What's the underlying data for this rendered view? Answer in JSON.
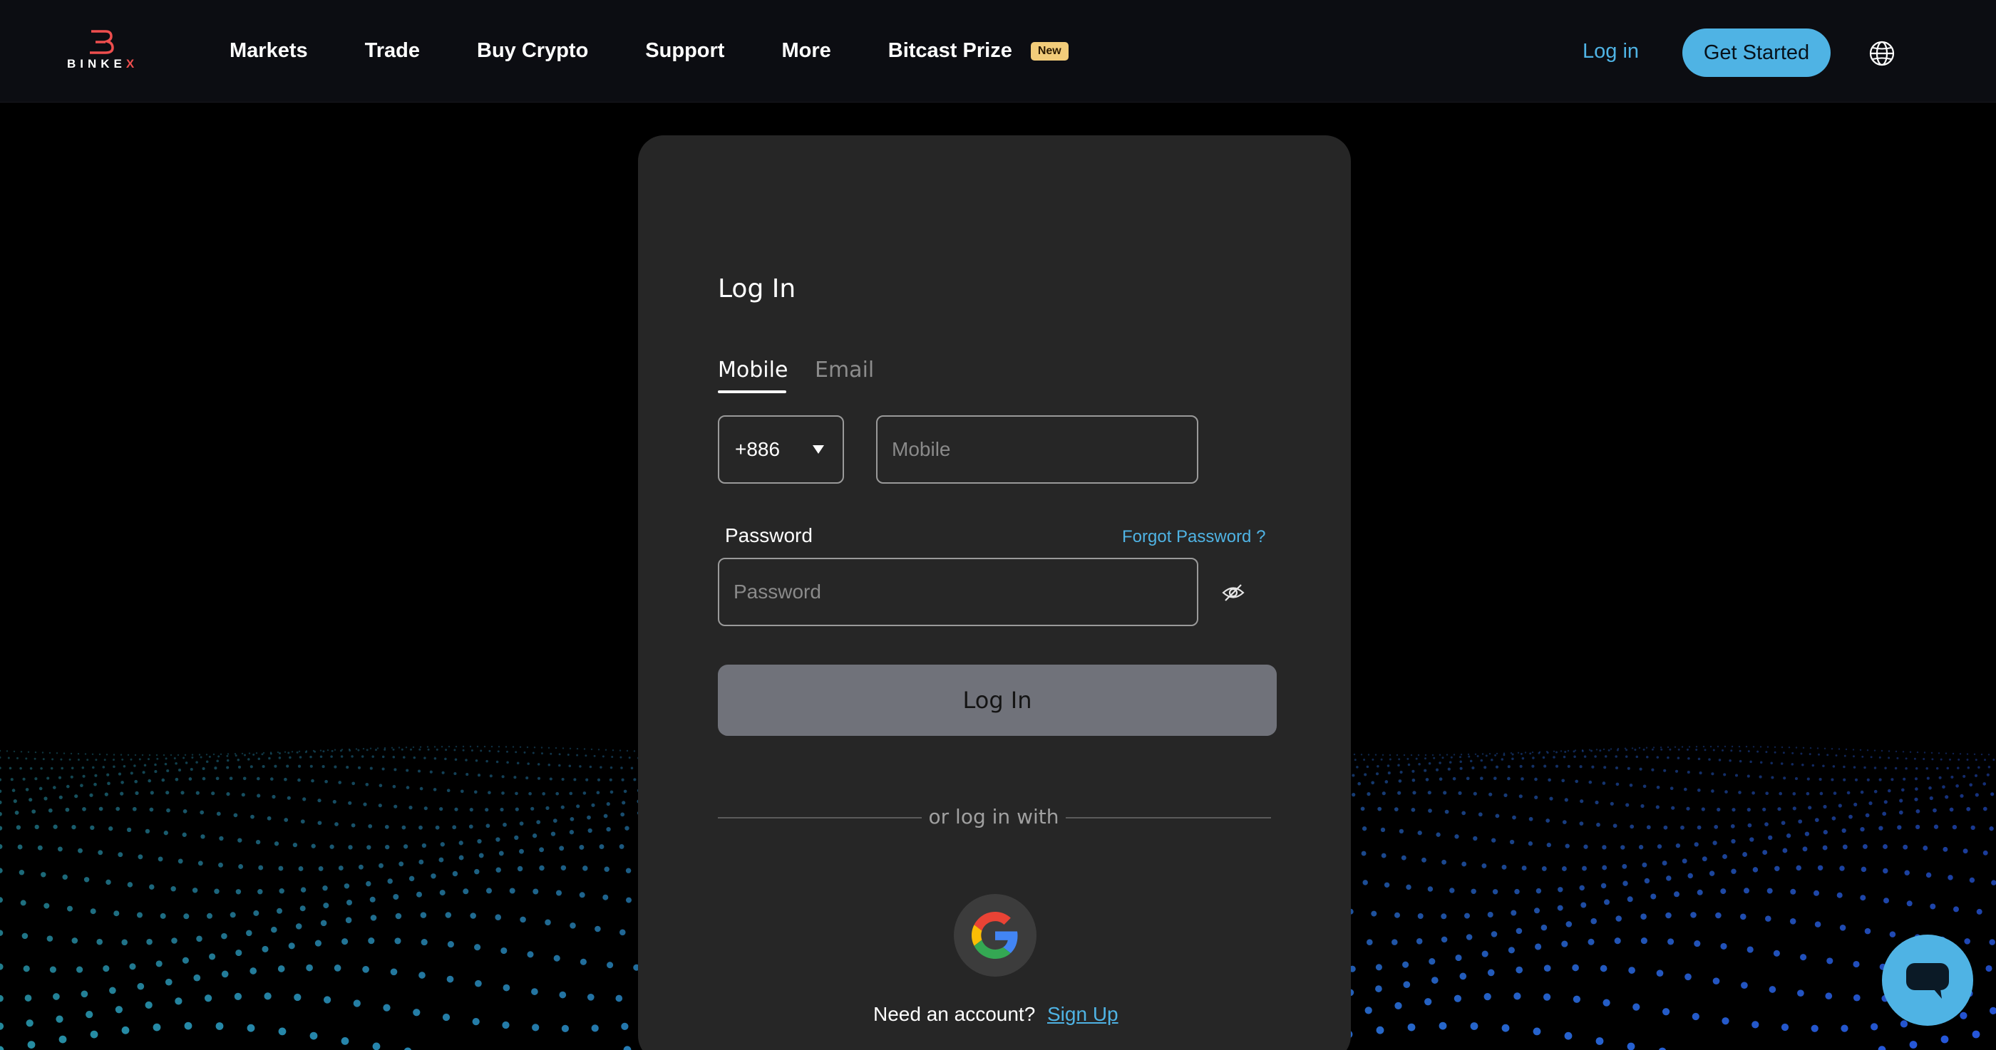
{
  "brand": {
    "logo_text": "BINKE",
    "logo_text_accent": "X",
    "accent_color": "#4fb3e4",
    "logo_color": "#ee4e4e"
  },
  "nav": {
    "items": [
      {
        "label": "Markets"
      },
      {
        "label": "Trade"
      },
      {
        "label": "Buy Crypto"
      },
      {
        "label": "Support"
      },
      {
        "label": "More"
      },
      {
        "label": "Bitcast Prize",
        "badge": "New"
      }
    ],
    "login_label": "Log in",
    "get_started_label": "Get Started",
    "language_icon": "globe-icon"
  },
  "login_form": {
    "title": "Log In",
    "tabs": [
      {
        "label": "Mobile",
        "active": true
      },
      {
        "label": "Email",
        "active": false
      }
    ],
    "country_code": "+886",
    "mobile_placeholder": "Mobile",
    "password_label": "Password",
    "forgot_password_label": "Forgot Password ?",
    "password_placeholder": "Password",
    "submit_label": "Log In",
    "divider_text": "or log in with",
    "social_login": [
      "google-icon"
    ],
    "need_account_text": "Need an account?",
    "signup_label": "Sign Up"
  },
  "chat": {
    "icon": "chat-bubble-icon"
  }
}
